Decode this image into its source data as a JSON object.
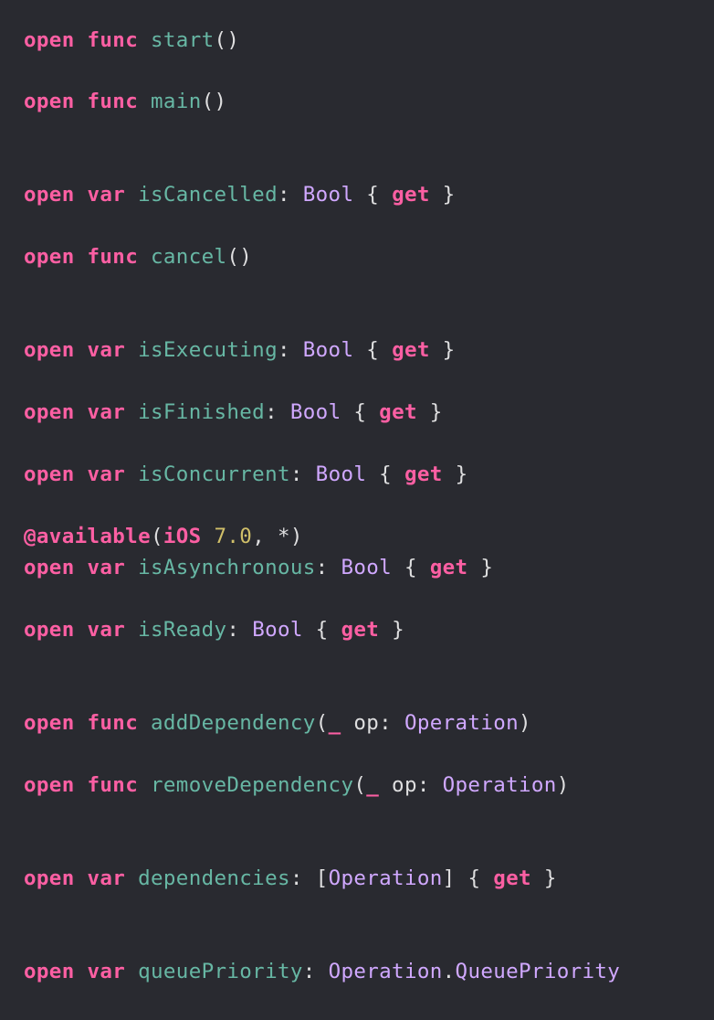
{
  "colors": {
    "background": "#292a30",
    "keyword": "#fc5fa3",
    "declaration": "#67b7a4",
    "type": "#d0a8ff",
    "number": "#d0bf69",
    "plain": "#dfdfe0"
  },
  "code": {
    "lines": [
      {
        "tokens": [
          {
            "text": "open",
            "kind": "kw"
          },
          {
            "text": " ",
            "kind": "pl"
          },
          {
            "text": "func",
            "kind": "kw"
          },
          {
            "text": " ",
            "kind": "pl"
          },
          {
            "text": "start",
            "kind": "fn"
          },
          {
            "text": "()",
            "kind": "pl"
          }
        ]
      },
      {
        "tokens": [
          {
            "text": "open",
            "kind": "kw"
          },
          {
            "text": " ",
            "kind": "pl"
          },
          {
            "text": "func",
            "kind": "kw"
          },
          {
            "text": " ",
            "kind": "pl"
          },
          {
            "text": "main",
            "kind": "fn"
          },
          {
            "text": "()",
            "kind": "pl"
          }
        ]
      },
      {
        "tokens": [
          {
            "text": "open",
            "kind": "kw"
          },
          {
            "text": " ",
            "kind": "pl"
          },
          {
            "text": "var",
            "kind": "kw"
          },
          {
            "text": " ",
            "kind": "pl"
          },
          {
            "text": "isCancelled",
            "kind": "fn"
          },
          {
            "text": ": ",
            "kind": "pl"
          },
          {
            "text": "Bool",
            "kind": "ty"
          },
          {
            "text": " { ",
            "kind": "pl"
          },
          {
            "text": "get",
            "kind": "kw"
          },
          {
            "text": " }",
            "kind": "pl"
          }
        ]
      },
      {
        "tokens": [
          {
            "text": "open",
            "kind": "kw"
          },
          {
            "text": " ",
            "kind": "pl"
          },
          {
            "text": "func",
            "kind": "kw"
          },
          {
            "text": " ",
            "kind": "pl"
          },
          {
            "text": "cancel",
            "kind": "fn"
          },
          {
            "text": "()",
            "kind": "pl"
          }
        ]
      },
      {
        "tokens": [
          {
            "text": "open",
            "kind": "kw"
          },
          {
            "text": " ",
            "kind": "pl"
          },
          {
            "text": "var",
            "kind": "kw"
          },
          {
            "text": " ",
            "kind": "pl"
          },
          {
            "text": "isExecuting",
            "kind": "fn"
          },
          {
            "text": ": ",
            "kind": "pl"
          },
          {
            "text": "Bool",
            "kind": "ty"
          },
          {
            "text": " { ",
            "kind": "pl"
          },
          {
            "text": "get",
            "kind": "kw"
          },
          {
            "text": " }",
            "kind": "pl"
          }
        ]
      },
      {
        "tokens": [
          {
            "text": "open",
            "kind": "kw"
          },
          {
            "text": " ",
            "kind": "pl"
          },
          {
            "text": "var",
            "kind": "kw"
          },
          {
            "text": " ",
            "kind": "pl"
          },
          {
            "text": "isFinished",
            "kind": "fn"
          },
          {
            "text": ": ",
            "kind": "pl"
          },
          {
            "text": "Bool",
            "kind": "ty"
          },
          {
            "text": " { ",
            "kind": "pl"
          },
          {
            "text": "get",
            "kind": "kw"
          },
          {
            "text": " }",
            "kind": "pl"
          }
        ]
      },
      {
        "tokens": [
          {
            "text": "open",
            "kind": "kw"
          },
          {
            "text": " ",
            "kind": "pl"
          },
          {
            "text": "var",
            "kind": "kw"
          },
          {
            "text": " ",
            "kind": "pl"
          },
          {
            "text": "isConcurrent",
            "kind": "fn"
          },
          {
            "text": ": ",
            "kind": "pl"
          },
          {
            "text": "Bool",
            "kind": "ty"
          },
          {
            "text": " { ",
            "kind": "pl"
          },
          {
            "text": "get",
            "kind": "kw"
          },
          {
            "text": " }",
            "kind": "pl"
          }
        ]
      },
      {
        "tokens": [
          {
            "text": "@available",
            "kind": "kw"
          },
          {
            "text": "(",
            "kind": "pl"
          },
          {
            "text": "iOS",
            "kind": "kw"
          },
          {
            "text": " ",
            "kind": "pl"
          },
          {
            "text": "7.0",
            "kind": "nu"
          },
          {
            "text": ", *)",
            "kind": "pl"
          }
        ]
      },
      {
        "tokens": [
          {
            "text": "open",
            "kind": "kw"
          },
          {
            "text": " ",
            "kind": "pl"
          },
          {
            "text": "var",
            "kind": "kw"
          },
          {
            "text": " ",
            "kind": "pl"
          },
          {
            "text": "isAsynchronous",
            "kind": "fn"
          },
          {
            "text": ": ",
            "kind": "pl"
          },
          {
            "text": "Bool",
            "kind": "ty"
          },
          {
            "text": " { ",
            "kind": "pl"
          },
          {
            "text": "get",
            "kind": "kw"
          },
          {
            "text": " }",
            "kind": "pl"
          }
        ]
      },
      {
        "tokens": [
          {
            "text": "open",
            "kind": "kw"
          },
          {
            "text": " ",
            "kind": "pl"
          },
          {
            "text": "var",
            "kind": "kw"
          },
          {
            "text": " ",
            "kind": "pl"
          },
          {
            "text": "isReady",
            "kind": "fn"
          },
          {
            "text": ": ",
            "kind": "pl"
          },
          {
            "text": "Bool",
            "kind": "ty"
          },
          {
            "text": " { ",
            "kind": "pl"
          },
          {
            "text": "get",
            "kind": "kw"
          },
          {
            "text": " }",
            "kind": "pl"
          }
        ]
      },
      {
        "tokens": [
          {
            "text": "open",
            "kind": "kw"
          },
          {
            "text": " ",
            "kind": "pl"
          },
          {
            "text": "func",
            "kind": "kw"
          },
          {
            "text": " ",
            "kind": "pl"
          },
          {
            "text": "addDependency",
            "kind": "fn"
          },
          {
            "text": "(",
            "kind": "pl"
          },
          {
            "text": "_",
            "kind": "kw"
          },
          {
            "text": " op: ",
            "kind": "pl"
          },
          {
            "text": "Operation",
            "kind": "ty"
          },
          {
            "text": ")",
            "kind": "pl"
          }
        ]
      },
      {
        "tokens": [
          {
            "text": "open",
            "kind": "kw"
          },
          {
            "text": " ",
            "kind": "pl"
          },
          {
            "text": "func",
            "kind": "kw"
          },
          {
            "text": " ",
            "kind": "pl"
          },
          {
            "text": "removeDependency",
            "kind": "fn"
          },
          {
            "text": "(",
            "kind": "pl"
          },
          {
            "text": "_",
            "kind": "kw"
          },
          {
            "text": " op: ",
            "kind": "pl"
          },
          {
            "text": "Operation",
            "kind": "ty"
          },
          {
            "text": ")",
            "kind": "pl"
          }
        ]
      },
      {
        "tokens": [
          {
            "text": "open",
            "kind": "kw"
          },
          {
            "text": " ",
            "kind": "pl"
          },
          {
            "text": "var",
            "kind": "kw"
          },
          {
            "text": " ",
            "kind": "pl"
          },
          {
            "text": "dependencies",
            "kind": "fn"
          },
          {
            "text": ": [",
            "kind": "pl"
          },
          {
            "text": "Operation",
            "kind": "ty"
          },
          {
            "text": "] { ",
            "kind": "pl"
          },
          {
            "text": "get",
            "kind": "kw"
          },
          {
            "text": " }",
            "kind": "pl"
          }
        ]
      },
      {
        "tokens": [
          {
            "text": "open",
            "kind": "kw"
          },
          {
            "text": " ",
            "kind": "pl"
          },
          {
            "text": "var",
            "kind": "kw"
          },
          {
            "text": " ",
            "kind": "pl"
          },
          {
            "text": "queuePriority",
            "kind": "fn"
          },
          {
            "text": ": ",
            "kind": "pl"
          },
          {
            "text": "Operation",
            "kind": "ty"
          },
          {
            "text": ".",
            "kind": "pl"
          },
          {
            "text": "QueuePriority",
            "kind": "ty"
          }
        ]
      }
    ]
  }
}
